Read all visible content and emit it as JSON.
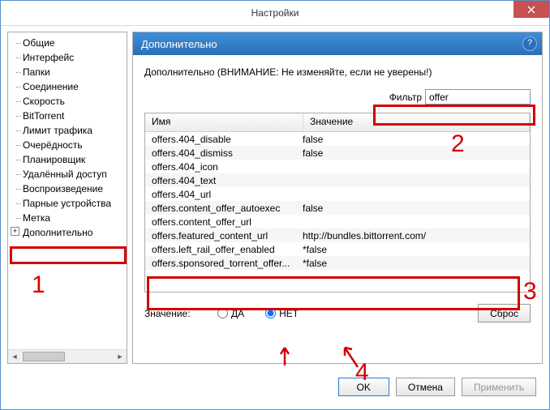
{
  "window": {
    "title": "Настройки"
  },
  "sidebar": {
    "items": [
      {
        "label": "Общие"
      },
      {
        "label": "Интерфейс"
      },
      {
        "label": "Папки"
      },
      {
        "label": "Соединение"
      },
      {
        "label": "Скорость"
      },
      {
        "label": "BitTorrent"
      },
      {
        "label": "Лимит трафика"
      },
      {
        "label": "Очерёдность"
      },
      {
        "label": "Планировщик"
      },
      {
        "label": "Удалённый доступ"
      },
      {
        "label": "Воспроизведение"
      },
      {
        "label": "Парные устройства"
      },
      {
        "label": "Метка"
      },
      {
        "label": "Дополнительно",
        "expandable": true
      }
    ]
  },
  "panel": {
    "heading": "Дополнительно",
    "warning": "Дополнительно (ВНИМАНИЕ: Не изменяйте, если не уверены!)",
    "filter_label": "Фильтр",
    "filter_value": "offer",
    "columns": {
      "name": "Имя",
      "value": "Значение"
    },
    "rows": [
      {
        "name": "offers.404_disable",
        "value": "false"
      },
      {
        "name": "offers.404_dismiss",
        "value": "false"
      },
      {
        "name": "offers.404_icon",
        "value": ""
      },
      {
        "name": "offers.404_text",
        "value": ""
      },
      {
        "name": "offers.404_url",
        "value": ""
      },
      {
        "name": "offers.content_offer_autoexec",
        "value": "false"
      },
      {
        "name": "offers.content_offer_url",
        "value": ""
      },
      {
        "name": "offers.featured_content_url",
        "value": "http://bundles.bittorrent.com/"
      },
      {
        "name": "offers.left_rail_offer_enabled",
        "value": "*false"
      },
      {
        "name": "offers.sponsored_torrent_offer...",
        "value": "*false"
      }
    ],
    "value_label": "Значение:",
    "radio_yes": "ДА",
    "radio_no": "НЕТ",
    "reset": "Сброс"
  },
  "buttons": {
    "ok": "OK",
    "cancel": "Отмена",
    "apply": "Применить"
  },
  "annotations": {
    "n1": "1",
    "n2": "2",
    "n3": "3",
    "n4": "4"
  }
}
